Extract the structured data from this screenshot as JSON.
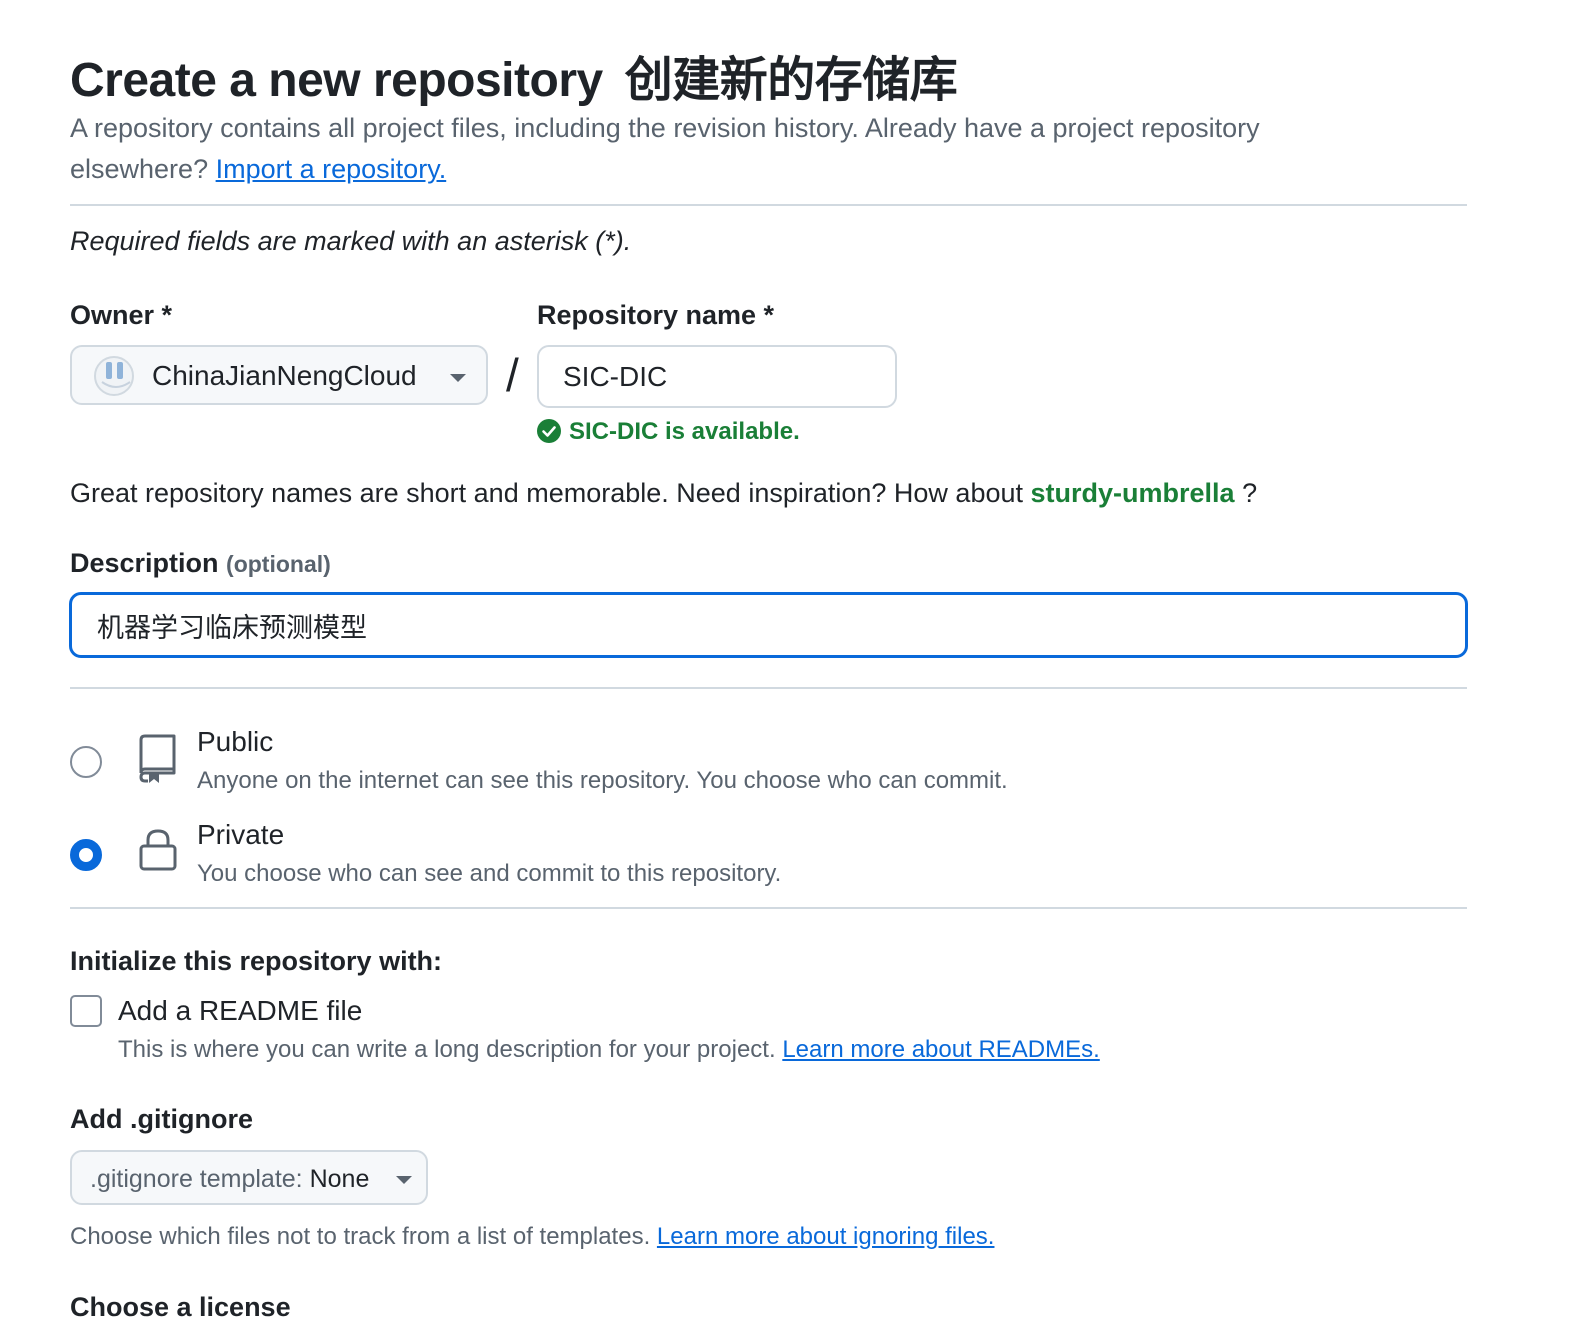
{
  "header": {
    "title": "Create a new repository",
    "title_cn": "创建新的存储库",
    "subtitle": "A repository contains all project files, including the revision history. Already have a project repository elsewhere?",
    "import_link": "Import a repository."
  },
  "form": {
    "required_note": "Required fields are marked with an asterisk (*).",
    "owner": {
      "label": "Owner *",
      "value": "ChinaJianNengCloud"
    },
    "separator": "/",
    "repo_name": {
      "label": "Repository name *",
      "value": "SIC-DIC",
      "availability": "SIC-DIC is available."
    },
    "suggestion": {
      "text": "Great repository names are short and memorable. Need inspiration? How about",
      "name": "sturdy-umbrella",
      "suffix": "?"
    },
    "description": {
      "label": "Description",
      "optional": "(optional)",
      "value": "机器学习临床预测模型"
    },
    "visibility": [
      {
        "title": "Public",
        "description": "Anyone on the internet can see this repository. You choose who can commit.",
        "icon": "repo-icon",
        "selected": false
      },
      {
        "title": "Private",
        "description": "You choose who can see and commit to this repository.",
        "icon": "lock-icon",
        "selected": true
      }
    ],
    "initialize": {
      "heading": "Initialize this repository with:",
      "readme_label": "Add a README file",
      "readme_checked": false,
      "readme_desc": "This is where you can write a long description for your project.",
      "readme_link": "Learn more about READMEs."
    },
    "gitignore": {
      "heading": "Add .gitignore",
      "select_prefix": ".gitignore template:",
      "select_value": "None",
      "help": "Choose which files not to track from a list of templates.",
      "help_link": "Learn more about ignoring files."
    },
    "license": {
      "heading": "Choose a license"
    }
  },
  "colors": {
    "link": "#0969da",
    "success": "#1a7f37",
    "focus": "#0969da",
    "muted": "#59636e",
    "border": "#d1d9e0"
  }
}
